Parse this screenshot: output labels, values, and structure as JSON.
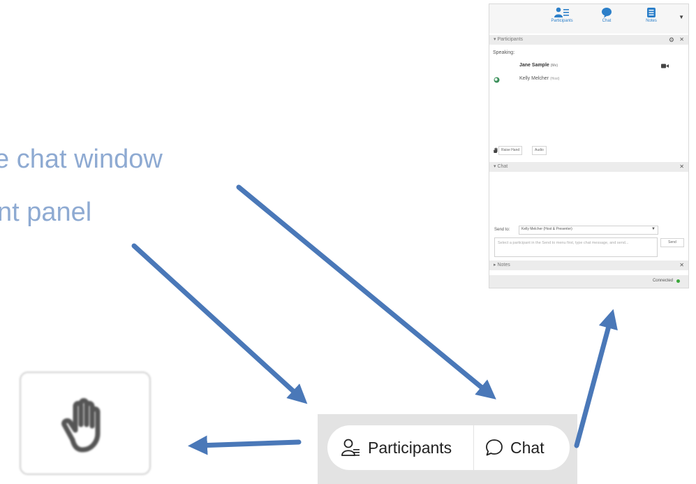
{
  "captions": {
    "line1": "e chat window",
    "line2": "nt panel"
  },
  "panel": {
    "tabs": [
      {
        "label": "Participants",
        "icon": "participants-icon"
      },
      {
        "label": "Chat",
        "icon": "chat-bubble-icon"
      },
      {
        "label": "Notes",
        "icon": "notes-icon"
      }
    ],
    "participants": {
      "header": "Participants",
      "speaking_label": "Speaking:",
      "list": [
        {
          "name": "Jane Sample",
          "role": "(Me)"
        },
        {
          "name": "Kelly Melcher",
          "role": "(Host)"
        }
      ],
      "raise_hand": "Raise Hand",
      "audio": "Audio"
    },
    "chat": {
      "header": "Chat",
      "send_to_label": "Send to:",
      "send_to_value": "Kelly Melcher (Host & Presenter)",
      "message_placeholder": "Select a participant in the Send to menu first, type chat message, and send...",
      "send_button": "Send"
    },
    "notes": {
      "header": "Notes"
    },
    "status": "Connected",
    "colors": {
      "accent": "#2c7fc9",
      "connected": "#3aa63a"
    }
  },
  "toolbar": {
    "participants_label": "Participants",
    "chat_label": "Chat"
  },
  "annotation": {
    "arrow_color": "#4a78b8",
    "caption_color": "#8eaad2"
  }
}
